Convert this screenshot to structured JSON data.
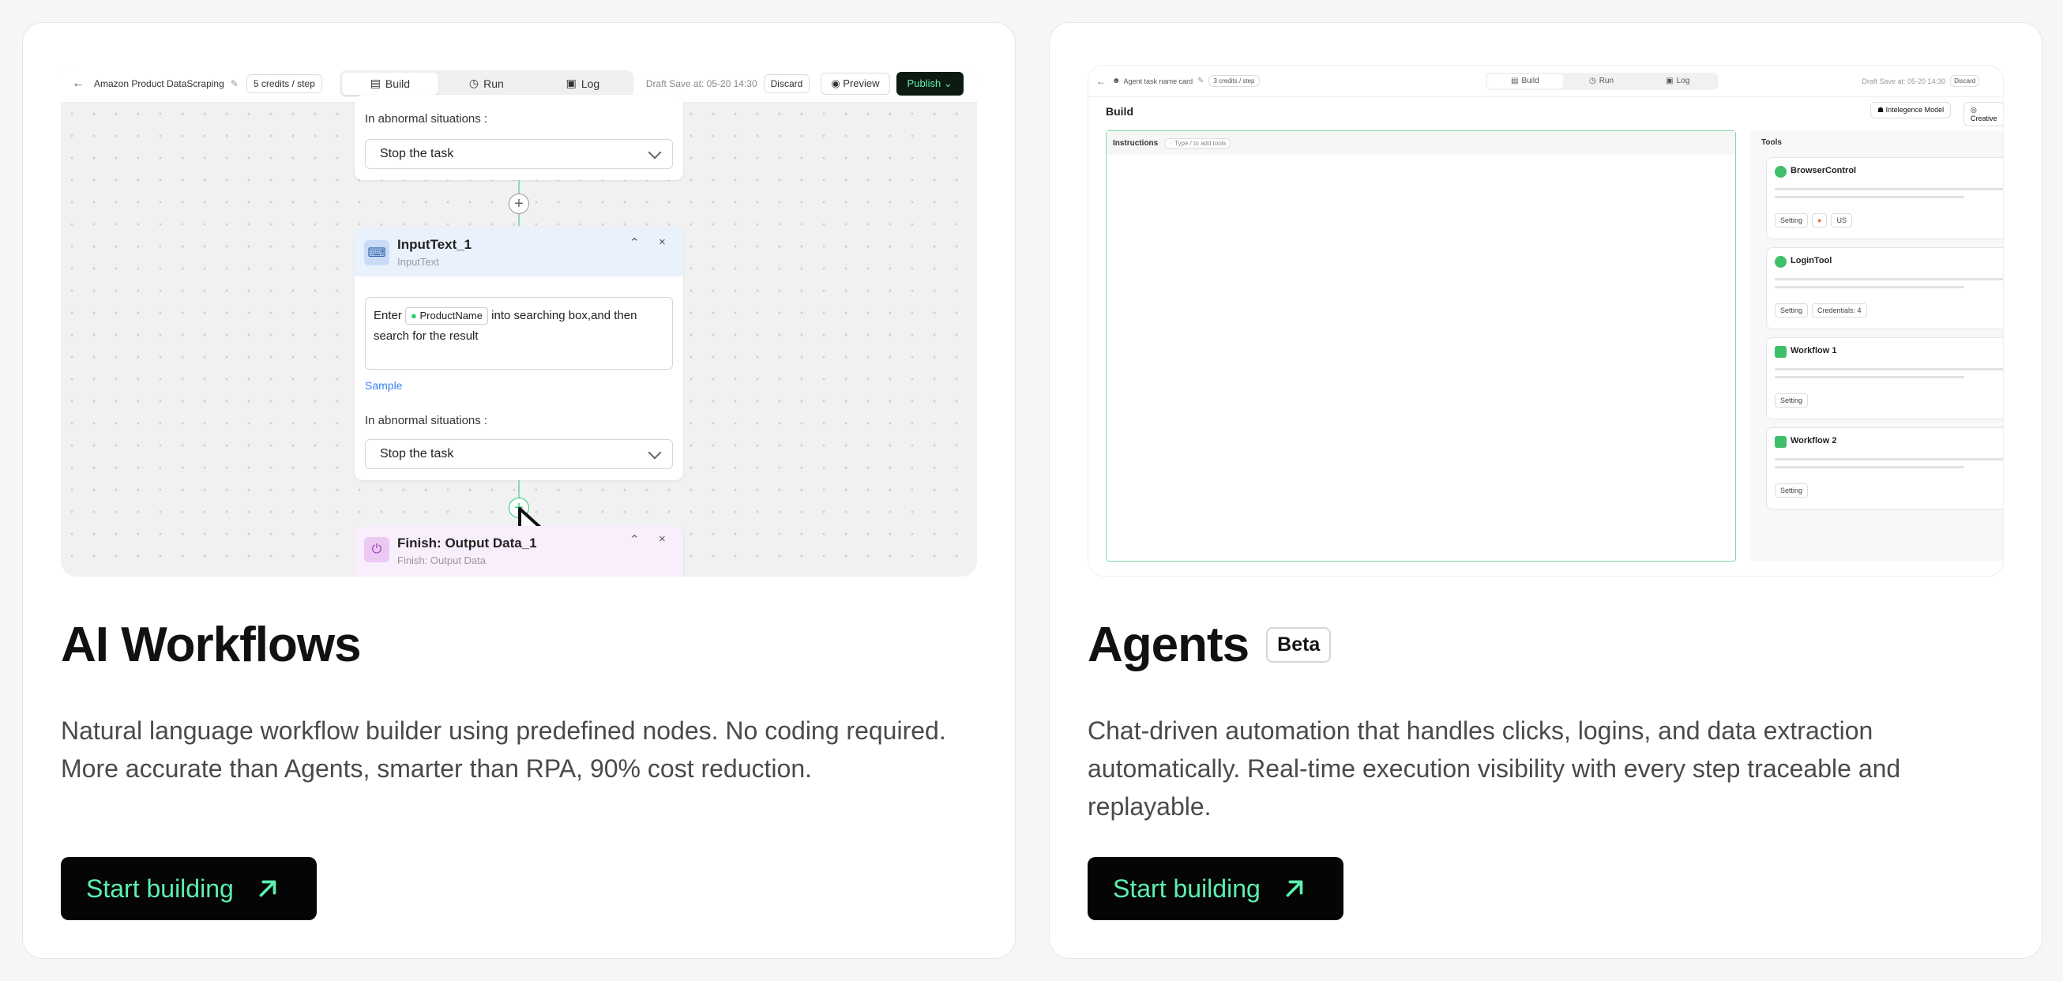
{
  "cards": [
    {
      "title": "AI Workflows",
      "description": "Natural language workflow builder using predefined nodes. No coding required. More accurate than Agents, smarter than RPA, 90% cost reduction.",
      "cta": "Start building",
      "preview": {
        "project_name": "Amazon Product DataScraping",
        "credits": "5 credits / step",
        "tabs": [
          "Build",
          "Run",
          "Log"
        ],
        "draft_save": "Draft Save at: 05-20 14:30",
        "discard": "Discard",
        "preview": "Preview",
        "publish": "Publish",
        "abnormal_label": "In abnormal situations :",
        "stop_task": "Stop the task",
        "node_title": "InputText_1",
        "node_subtitle": "InputText",
        "prompt_pre": "Enter",
        "prompt_var": "ProductName",
        "prompt_post": "into searching box,and then search for the result",
        "sample": "Sample",
        "finish_title": "Finish: Output Data_1",
        "finish_subtitle": "Finish: Output Data"
      }
    },
    {
      "title": "Agents",
      "badge": "Beta",
      "description": "Chat-driven automation that handles clicks, logins, and data extraction automatically. Real-time execution visibility with every step traceable and replayable.",
      "cta": "Start building",
      "preview": {
        "name": "Agent task name card",
        "credits": "3 credits / step",
        "tabs": [
          "Build",
          "Run",
          "Log"
        ],
        "draft_save": "Draft Save at: 05-20 14:30",
        "discard": "Discard",
        "build_heading": "Build",
        "model": "Intelegence Model",
        "creative": "Creative",
        "instructions": "Instructions",
        "instructions_hint": "Type / to add tools",
        "tools_heading": "Tools",
        "tools": [
          {
            "name": "BrowserControl",
            "buttons": [
              "Setting",
              "",
              "US"
            ],
            "color": "#3fbf6a"
          },
          {
            "name": "LoginTool",
            "buttons": [
              "Setting",
              "Credentials: 4"
            ],
            "color": "#3fbf6a"
          },
          {
            "name": "Workflow 1",
            "buttons": [
              "Setting"
            ],
            "color": "#3fbf6a"
          },
          {
            "name": "Workflow 2",
            "buttons": [
              "Setting"
            ],
            "color": "#3fbf6a"
          }
        ]
      }
    }
  ],
  "colors": {
    "cta_bg": "#050505",
    "cta_text": "#5df0b0",
    "accent_green": "#2ecc71",
    "publish_bg": "#0d1a12"
  }
}
